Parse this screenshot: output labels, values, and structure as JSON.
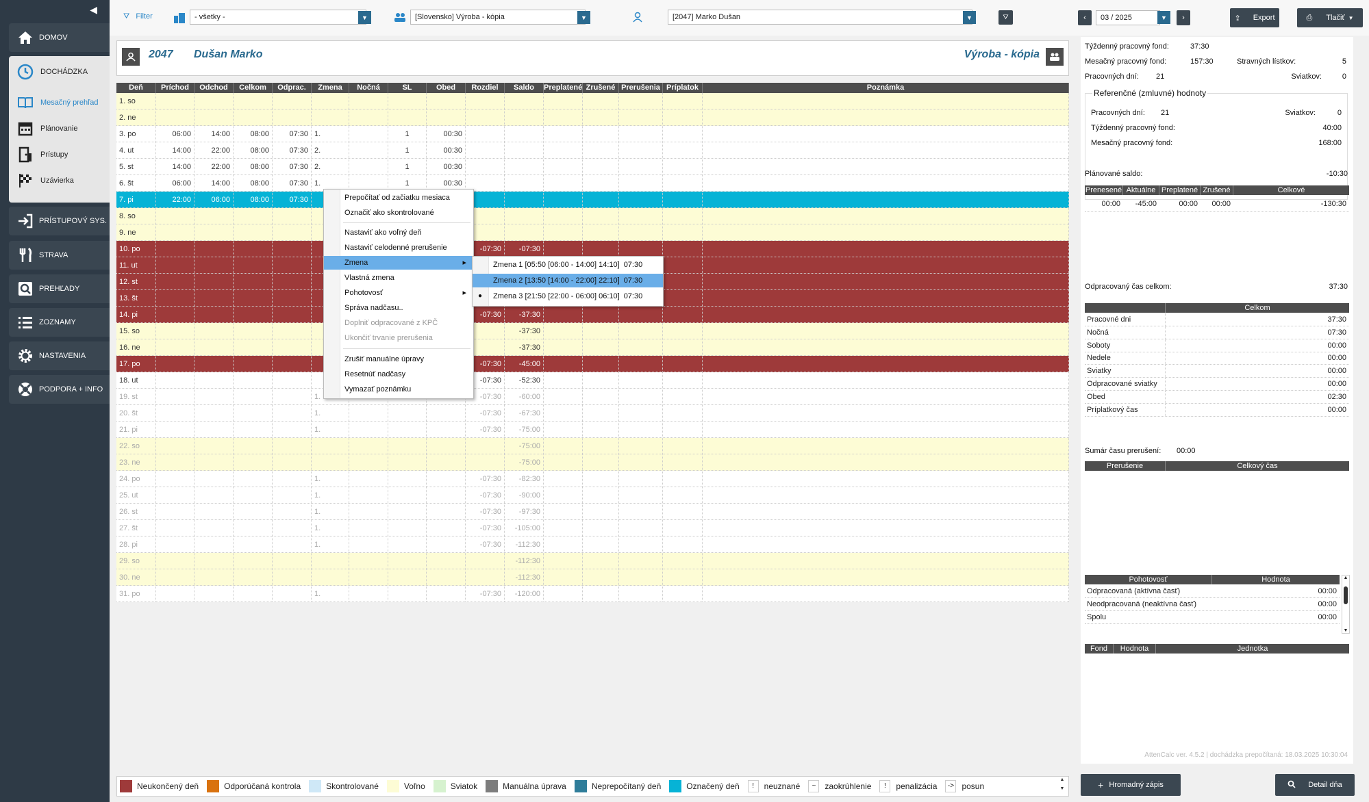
{
  "sidebar": {
    "items": [
      {
        "label": "DOMOV"
      },
      {
        "label": "DOCHÁDZKA"
      },
      {
        "label": "PRÍSTUPOVÝ SYS."
      },
      {
        "label": "STRAVA"
      },
      {
        "label": "PREHĽADY"
      },
      {
        "label": "ZOZNAMY"
      },
      {
        "label": "NASTAVENIA"
      },
      {
        "label": "PODPORA + INFO"
      }
    ],
    "sub": [
      "Mesačný prehľad",
      "Plánovanie",
      "Prístupy",
      "Uzávierka"
    ]
  },
  "topbar": {
    "filter": "Filter",
    "org": "- všetky -",
    "dept": "[Slovensko] Výroba - kópia",
    "employee": "[2047] Marko Dušan",
    "period": "03 / 2025",
    "export": "Export",
    "print": "Tlačiť"
  },
  "employee": {
    "id": "2047",
    "name": "Dušan Marko",
    "dept": "Výroba - kópia"
  },
  "table": {
    "headers": [
      "Deň",
      "Príchod",
      "Odchod",
      "Celkom",
      "Odprac.",
      "Zmena",
      "Nočná",
      "SL",
      "Obed",
      "Rozdiel",
      "Saldo",
      "Preplatené",
      "Zrušené",
      "Prerušenia",
      "Príplatok",
      "Poznámka"
    ],
    "rows": [
      {
        "c": [
          "1. so",
          "",
          "",
          "",
          "",
          "",
          "",
          "",
          "",
          "",
          "",
          "",
          "",
          "",
          "",
          ""
        ],
        "t": "yellow"
      },
      {
        "c": [
          "2. ne",
          "",
          "",
          "",
          "",
          "",
          "",
          "",
          "",
          "",
          "",
          "",
          "",
          "",
          "",
          ""
        ],
        "t": "yellow"
      },
      {
        "c": [
          "3. po",
          "06:00",
          "14:00",
          "08:00",
          "07:30",
          "1.",
          "",
          "1",
          "00:30",
          "",
          "",
          "",
          "",
          "",
          "",
          ""
        ],
        "t": "white"
      },
      {
        "c": [
          "4. ut",
          "14:00",
          "22:00",
          "08:00",
          "07:30",
          "2.",
          "",
          "1",
          "00:30",
          "",
          "",
          "",
          "",
          "",
          "",
          ""
        ],
        "t": "white"
      },
      {
        "c": [
          "5. st",
          "14:00",
          "22:00",
          "08:00",
          "07:30",
          "2.",
          "",
          "1",
          "00:30",
          "",
          "",
          "",
          "",
          "",
          "",
          ""
        ],
        "t": "white"
      },
      {
        "c": [
          "6. št",
          "06:00",
          "14:00",
          "08:00",
          "07:30",
          "1.",
          "",
          "1",
          "00:30",
          "",
          "",
          "",
          "",
          "",
          "",
          ""
        ],
        "t": "white"
      },
      {
        "c": [
          "7. pi",
          "22:00",
          "06:00",
          "08:00",
          "07:30",
          "",
          "",
          "",
          "",
          "",
          "",
          "",
          "",
          "",
          "",
          ""
        ],
        "t": "cyan"
      },
      {
        "c": [
          "8. so",
          "",
          "",
          "",
          "",
          "",
          "",
          "",
          "",
          "",
          "",
          "",
          "",
          "",
          "",
          ""
        ],
        "t": "yellow"
      },
      {
        "c": [
          "9. ne",
          "",
          "",
          "",
          "",
          "",
          "",
          "",
          "",
          "",
          "",
          "",
          "",
          "",
          "",
          ""
        ],
        "t": "yellow"
      },
      {
        "c": [
          "10. po",
          "",
          "",
          "",
          "",
          "",
          "",
          "",
          "",
          "-07:30",
          "-07:30",
          "",
          "",
          "",
          "",
          ""
        ],
        "t": "red"
      },
      {
        "c": [
          "11. ut",
          "",
          "",
          "",
          "",
          "",
          "",
          "",
          "",
          "",
          "",
          "",
          "",
          "",
          "",
          ""
        ],
        "t": "red"
      },
      {
        "c": [
          "12. st",
          "",
          "",
          "",
          "",
          "",
          "",
          "",
          "",
          "",
          "",
          "",
          "",
          "",
          "",
          ""
        ],
        "t": "red"
      },
      {
        "c": [
          "13. št",
          "",
          "",
          "",
          "",
          "",
          "",
          "",
          "",
          "",
          "",
          "",
          "",
          "",
          "",
          ""
        ],
        "t": "red"
      },
      {
        "c": [
          "14. pi",
          "",
          "",
          "",
          "",
          "",
          "",
          "",
          "",
          "-07:30",
          "-37:30",
          "",
          "",
          "",
          "",
          ""
        ],
        "t": "red"
      },
      {
        "c": [
          "15. so",
          "",
          "",
          "",
          "",
          "",
          "",
          "",
          "",
          "",
          "-37:30",
          "",
          "",
          "",
          "",
          ""
        ],
        "t": "yellow"
      },
      {
        "c": [
          "16. ne",
          "",
          "",
          "",
          "",
          "",
          "",
          "",
          "",
          "",
          "-37:30",
          "",
          "",
          "",
          "",
          ""
        ],
        "t": "yellow"
      },
      {
        "c": [
          "17. po",
          "",
          "",
          "",
          "",
          "",
          "",
          "",
          "",
          "-07:30",
          "-45:00",
          "",
          "",
          "",
          "",
          ""
        ],
        "t": "red"
      },
      {
        "c": [
          "18. ut",
          "",
          "",
          "",
          "",
          "",
          "",
          "",
          "",
          "-07:30",
          "-52:30",
          "",
          "",
          "",
          "",
          ""
        ],
        "t": "white"
      },
      {
        "c": [
          "19. st",
          "",
          "",
          "",
          "",
          "1.",
          "",
          "",
          "",
          "-07:30",
          "-60:00",
          "",
          "",
          "",
          "",
          ""
        ],
        "t": "future"
      },
      {
        "c": [
          "20. št",
          "",
          "",
          "",
          "",
          "1.",
          "",
          "",
          "",
          "-07:30",
          "-67:30",
          "",
          "",
          "",
          "",
          ""
        ],
        "t": "future"
      },
      {
        "c": [
          "21. pi",
          "",
          "",
          "",
          "",
          "1.",
          "",
          "",
          "",
          "-07:30",
          "-75:00",
          "",
          "",
          "",
          "",
          ""
        ],
        "t": "future"
      },
      {
        "c": [
          "22. so",
          "",
          "",
          "",
          "",
          "",
          "",
          "",
          "",
          "",
          "-75:00",
          "",
          "",
          "",
          "",
          ""
        ],
        "t": "futurey"
      },
      {
        "c": [
          "23. ne",
          "",
          "",
          "",
          "",
          "",
          "",
          "",
          "",
          "",
          "-75:00",
          "",
          "",
          "",
          "",
          ""
        ],
        "t": "futurey"
      },
      {
        "c": [
          "24. po",
          "",
          "",
          "",
          "",
          "1.",
          "",
          "",
          "",
          "-07:30",
          "-82:30",
          "",
          "",
          "",
          "",
          ""
        ],
        "t": "future"
      },
      {
        "c": [
          "25. ut",
          "",
          "",
          "",
          "",
          "1.",
          "",
          "",
          "",
          "-07:30",
          "-90:00",
          "",
          "",
          "",
          "",
          ""
        ],
        "t": "future"
      },
      {
        "c": [
          "26. st",
          "",
          "",
          "",
          "",
          "1.",
          "",
          "",
          "",
          "-07:30",
          "-97:30",
          "",
          "",
          "",
          "",
          ""
        ],
        "t": "future"
      },
      {
        "c": [
          "27. št",
          "",
          "",
          "",
          "",
          "1.",
          "",
          "",
          "",
          "-07:30",
          "-105:00",
          "",
          "",
          "",
          "",
          ""
        ],
        "t": "future"
      },
      {
        "c": [
          "28. pi",
          "",
          "",
          "",
          "",
          "1.",
          "",
          "",
          "",
          "-07:30",
          "-112:30",
          "",
          "",
          "",
          "",
          ""
        ],
        "t": "future"
      },
      {
        "c": [
          "29. so",
          "",
          "",
          "",
          "",
          "",
          "",
          "",
          "",
          "",
          "-112:30",
          "",
          "",
          "",
          "",
          ""
        ],
        "t": "futurey"
      },
      {
        "c": [
          "30. ne",
          "",
          "",
          "",
          "",
          "",
          "",
          "",
          "",
          "",
          "-112:30",
          "",
          "",
          "",
          "",
          ""
        ],
        "t": "futurey"
      },
      {
        "c": [
          "31. po",
          "",
          "",
          "",
          "",
          "1.",
          "",
          "",
          "",
          "-07:30",
          "-120:00",
          "",
          "",
          "",
          "",
          ""
        ],
        "t": "future"
      }
    ]
  },
  "context_menu": {
    "items": [
      "Prepočítať od začiatku mesiaca",
      "Označiť ako skontrolované",
      "Nastaviť ako voľný deň",
      "Nastaviť celodenné prerušenie",
      "Zmena",
      "Vlastná zmena",
      "Pohotovosť",
      "Správa nadčasu..",
      "Doplniť odpracované z KPČ",
      "Ukončiť trvanie prerušenia",
      "Zrušiť manuálne úpravy",
      "Resetnúť nadčasy",
      "Vymazať poznámku"
    ],
    "submenu": [
      {
        "label": "Zmena 1 [05:50 [06:00 - 14:00] 14:10]",
        "time": "07:30"
      },
      {
        "label": "Zmena 2 [13:50 [14:00 - 22:00] 22:10]",
        "time": "07:30"
      },
      {
        "label": "Zmena 3 [21:50 [22:00 - 06:00] 06:10]",
        "time": "07:30"
      }
    ]
  },
  "right_panel": {
    "weekly_fund_label": "Týždenný pracovný fond:",
    "weekly_fund": "37:30",
    "monthly_fund_label": "Mesačný pracovný fond:",
    "monthly_fund": "157:30",
    "meal_label": "Stravných lístkov:",
    "meal": "5",
    "workdays_label": "Pracovných dní:",
    "workdays": "21",
    "holidays_label": "Sviatkov:",
    "holidays": "0",
    "ref_title": "Referenčné (zmluvné) hodnoty",
    "ref_workdays": "21",
    "ref_holidays": "0",
    "ref_weekly": "40:00",
    "ref_monthly": "168:00",
    "planned_label": "Plánované saldo:",
    "planned": "-10:30",
    "saldo_headers": [
      "Prenesené",
      "Aktuálne",
      "Preplatené",
      "Zrušené",
      "Celkové"
    ],
    "saldo_values": [
      "00:00",
      "-45:00",
      "00:00",
      "00:00",
      "-130:30"
    ],
    "total_label": "Odpracovaný čas celkom:",
    "total": "37:30",
    "sum_header": "Celkom",
    "sum_rows": [
      {
        "k": "Pracovné dni",
        "v": "37:30"
      },
      {
        "k": "Nočná",
        "v": "07:30"
      },
      {
        "k": "Soboty",
        "v": "00:00"
      },
      {
        "k": "Nedele",
        "v": "00:00"
      },
      {
        "k": "Sviatky",
        "v": "00:00"
      },
      {
        "k": "Odpracované sviatky",
        "v": "00:00"
      },
      {
        "k": "Obed",
        "v": "02:30"
      },
      {
        "k": "Príplatkový čas",
        "v": "00:00"
      }
    ],
    "interrupt_label": "Sumár času prerušení:",
    "interrupt": "00:00",
    "interrupt_headers": [
      "Prerušenie",
      "Celkový čas"
    ],
    "standby_headers": [
      "Pohotovosť",
      "Hodnota"
    ],
    "standby_rows": [
      {
        "k": "Odpracovaná (aktívna časť)",
        "v": "00:00"
      },
      {
        "k": "Neodpracovaná (neaktívna časť)",
        "v": "00:00"
      },
      {
        "k": "Spolu",
        "v": "00:00"
      }
    ],
    "fund_headers": [
      "Fond",
      "Hodnota",
      "Jednotka"
    ],
    "version": "AttenCalc ver. 4.5.2 | dochádzka prepočítaná: 18.03.2025 10:30:04"
  },
  "legend": {
    "items": [
      {
        "label": "Neukončený deň",
        "color": "#9e3a3a"
      },
      {
        "label": "Odporúčaná kontrola",
        "color": "#d9720f"
      },
      {
        "label": "Skontrolované",
        "color": "#cfe8f7"
      },
      {
        "label": "Voľno",
        "color": "#fdfcd5"
      },
      {
        "label": "Sviatok",
        "color": "#d6f2cf"
      },
      {
        "label": "Manuálna úprava",
        "color": "#7d7d7d"
      },
      {
        "label": "Neprepočítaný deň",
        "color": "#2f7d9a"
      },
      {
        "label": "Označený deň",
        "color": "#06b3d6"
      }
    ],
    "symbols": [
      {
        "sym": "!",
        "label": "neuznané"
      },
      {
        "sym": "~",
        "label": "zaokrúhlenie"
      },
      {
        "sym": "!",
        "label": "penalizácia"
      },
      {
        "sym": "->",
        "label": "posun"
      }
    ]
  },
  "bottom": {
    "bulk": "Hromadný zápis",
    "detail": "Detail dňa"
  }
}
